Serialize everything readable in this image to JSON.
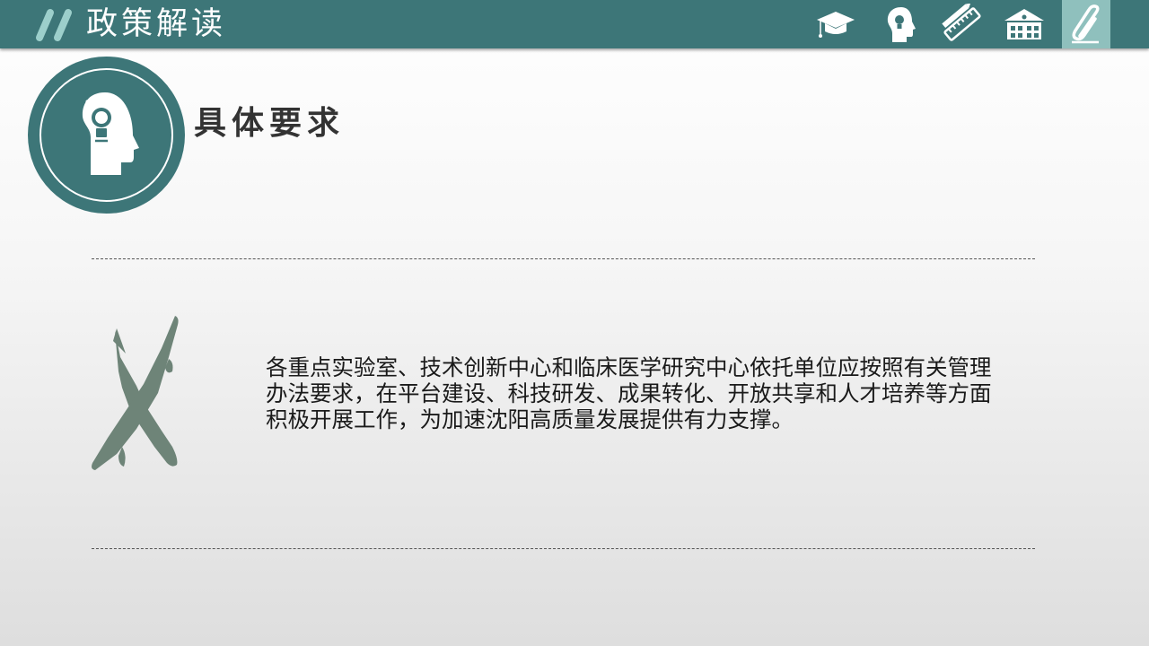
{
  "header": {
    "title": "政策解读",
    "nav": [
      {
        "name": "graduation-cap-icon",
        "active": false
      },
      {
        "name": "head-lightbulb-icon",
        "active": false
      },
      {
        "name": "pencil-ruler-icon",
        "active": false
      },
      {
        "name": "school-building-icon",
        "active": false
      },
      {
        "name": "paperclip-icon",
        "active": true
      }
    ],
    "colors": {
      "bar": "#3d7678",
      "active_tab": "#8fc0bd"
    }
  },
  "section": {
    "title": "具体要求",
    "icon": "head-lightbulb-icon"
  },
  "content": {
    "decoration_icon": "pencil-ruler-cross-icon",
    "text": "各重点实验室、技术创新中心和临床医学研究中心依托单位应按照有关管理办法要求，在平台建设、科技研发、成果转化、开放共享和人才培养等方面积极开展工作，为加速沈阳高质量发展提供有力支撑。"
  }
}
